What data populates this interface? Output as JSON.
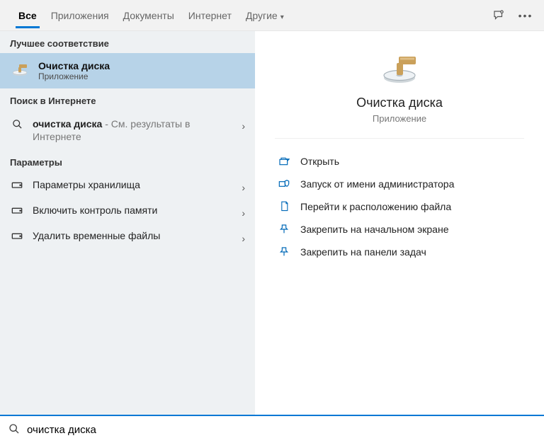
{
  "tabs": {
    "items": [
      "Все",
      "Приложения",
      "Документы",
      "Интернет",
      "Другие"
    ],
    "active_index": 0
  },
  "left": {
    "best_match_header": "Лучшее соответствие",
    "best_match": {
      "title": "Очистка диска",
      "subtitle": "Приложение"
    },
    "web_header": "Поиск в Интернете",
    "web": {
      "primary": "очистка диска",
      "suffix": " - См. результаты в Интернете"
    },
    "settings_header": "Параметры",
    "settings": [
      "Параметры хранилища",
      "Включить контроль памяти",
      "Удалить временные файлы"
    ]
  },
  "preview": {
    "title": "Очистка диска",
    "subtitle": "Приложение",
    "actions": [
      "Открыть",
      "Запуск от имени администратора",
      "Перейти к расположению файла",
      "Закрепить на начальном экране",
      "Закрепить на панели задач"
    ]
  },
  "search": {
    "value": "очистка диска"
  },
  "colors": {
    "accent": "#0078d4",
    "selected": "#b7d3e8"
  }
}
